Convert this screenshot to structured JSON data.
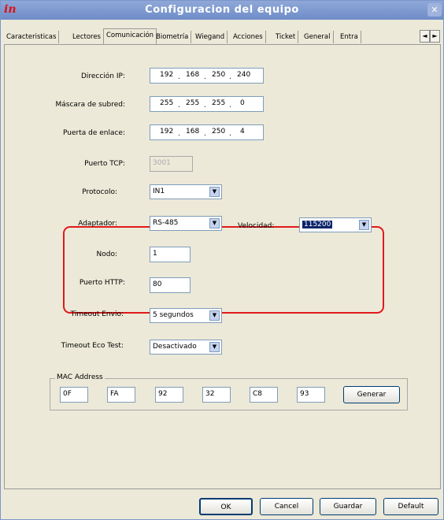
{
  "window": {
    "title": "Configuracion del equipo",
    "logo": "in",
    "close_icon": "✕"
  },
  "tabs": [
    {
      "label": "Caracteristicas"
    },
    {
      "label": "Lectores"
    },
    {
      "label": "Comunicación",
      "active": true
    },
    {
      "label": "Biometría"
    },
    {
      "label": "Wiegand"
    },
    {
      "label": "Acciones"
    },
    {
      "label": "Ticket"
    },
    {
      "label": "General"
    },
    {
      "label": "Entra"
    }
  ],
  "tab_scroll": {
    "left": "◄",
    "right": "►"
  },
  "form": {
    "ip": {
      "label": "Dirección IP:",
      "octets": [
        "192",
        "168",
        "250",
        "240"
      ]
    },
    "mask": {
      "label": "Máscara de subred:",
      "octets": [
        "255",
        "255",
        "255",
        "0"
      ]
    },
    "gateway": {
      "label": "Puerta de enlace:",
      "octets": [
        "192",
        "168",
        "250",
        "4"
      ]
    },
    "tcp": {
      "label": "Puerto TCP:",
      "value": "3001"
    },
    "protocol": {
      "label": "Protocolo:",
      "value": "IN1"
    },
    "adapter": {
      "label": "Adaptador:",
      "value": "RS-485"
    },
    "speed": {
      "label": "Velocidad:",
      "value": "115200"
    },
    "node": {
      "label": "Nodo:",
      "value": "1"
    },
    "http": {
      "label": "Puerto HTTP:",
      "value": "80"
    },
    "timeout_send": {
      "label": "Timeout Envio:",
      "value": "5 segundos"
    },
    "timeout_echo": {
      "label": "Timeout Eco Test:",
      "value": "Desactivado"
    }
  },
  "mac": {
    "title": "MAC Address",
    "octets": [
      "0F",
      "FA",
      "92",
      "32",
      "C8",
      "93"
    ],
    "generate_label": "Generar"
  },
  "footer": {
    "ok": "OK",
    "cancel": "Cancel",
    "save": "Guardar",
    "default": "Default"
  },
  "colors": {
    "highlight_border": "#e01a1a",
    "selection": "#0a246a"
  }
}
